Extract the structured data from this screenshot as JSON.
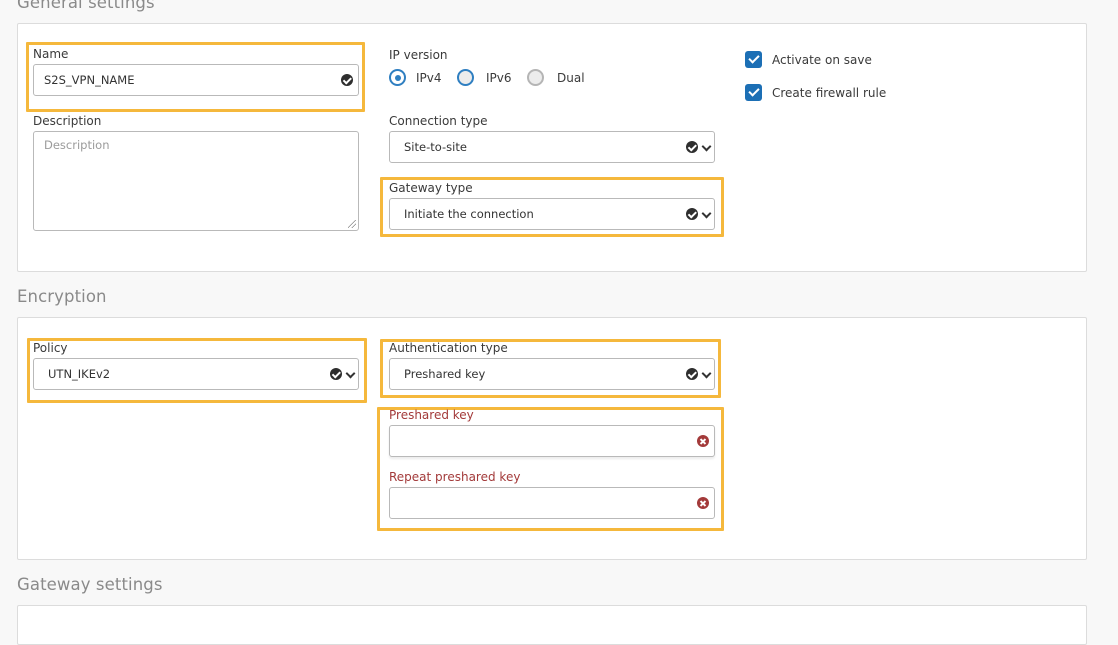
{
  "sections": {
    "general": {
      "title": "General settings",
      "name": {
        "label": "Name",
        "value": "S2S_VPN_NAME",
        "status_icon": "check-circle-icon"
      },
      "description": {
        "label": "Description",
        "placeholder": "Description",
        "value": ""
      },
      "ip_version": {
        "label": "IP version",
        "options": [
          {
            "label": "IPv4",
            "state": "selected"
          },
          {
            "label": "IPv6",
            "state": "unselected"
          },
          {
            "label": "Dual",
            "state": "disabled"
          }
        ]
      },
      "connection_type": {
        "label": "Connection type",
        "value": "Site-to-site"
      },
      "gateway_type": {
        "label": "Gateway type",
        "value": "Initiate the connection"
      },
      "checkboxes": [
        {
          "label": "Activate on save",
          "checked": true
        },
        {
          "label": "Create firewall rule",
          "checked": true
        }
      ]
    },
    "encryption": {
      "title": "Encryption",
      "policy": {
        "label": "Policy",
        "value": "UTN_IKEv2"
      },
      "authentication_type": {
        "label": "Authentication type",
        "value": "Preshared key"
      },
      "preshared_key": {
        "label": "Preshared key",
        "value": "",
        "status_icon": "error-circle-icon"
      },
      "repeat_preshared_key": {
        "label": "Repeat preshared key",
        "value": "",
        "status_icon": "error-circle-icon"
      }
    },
    "gateway": {
      "title": "Gateway settings"
    }
  },
  "colors": {
    "highlight": "#f5b83c",
    "accent": "#1c6fb5",
    "error": "#a33a3a",
    "background": "#f8f8f8"
  }
}
